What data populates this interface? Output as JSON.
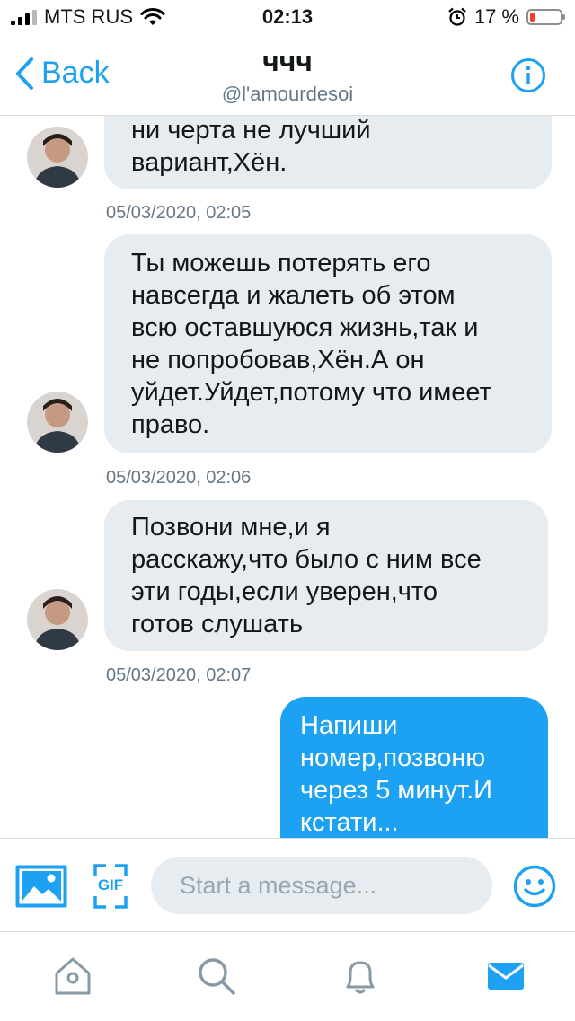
{
  "status_bar": {
    "carrier": "MTS RUS",
    "time": "02:13",
    "battery_percent": "17 %",
    "battery_level": 0.17
  },
  "header": {
    "back_label": "Back",
    "title": "ччч",
    "handle": "@l'amourdesoi"
  },
  "messages": [
    {
      "direction": "in",
      "text_lines": [
        "ни черта не лучший",
        "вариант,Хён."
      ],
      "timestamp": "05/03/2020, 02:05"
    },
    {
      "direction": "in",
      "text_lines": [
        "Ты можешь потерять его",
        "навсегда и жалеть об этом",
        "всю оставшуюся жизнь,так и",
        "не попробовав,Хён.А он",
        "уйдет.Уйдет,потому что имеет",
        "право."
      ],
      "timestamp": "05/03/2020, 02:06"
    },
    {
      "direction": "in",
      "text_lines": [
        "Позвони мне,и я",
        "расскажу,что было с ним все",
        "эти годы,если уверен,что",
        "готов слушать"
      ],
      "timestamp": "05/03/2020, 02:07"
    },
    {
      "direction": "out",
      "text_lines": [
        "Напиши",
        "номер,позвоню",
        "через 5 минут.И",
        "кстати..."
      ]
    }
  ],
  "composer": {
    "placeholder": "Start a message...",
    "gif_label": "GIF"
  },
  "colors": {
    "accent": "#1da1f2",
    "incoming_bubble": "#e6ecf0",
    "muted_text": "#657786",
    "battery_low": "#ff3b30"
  },
  "icons": {
    "tabs": [
      "home-icon",
      "search-icon",
      "notifications-bell-icon",
      "messages-envelope-icon"
    ],
    "active_tab": "messages-envelope-icon"
  }
}
